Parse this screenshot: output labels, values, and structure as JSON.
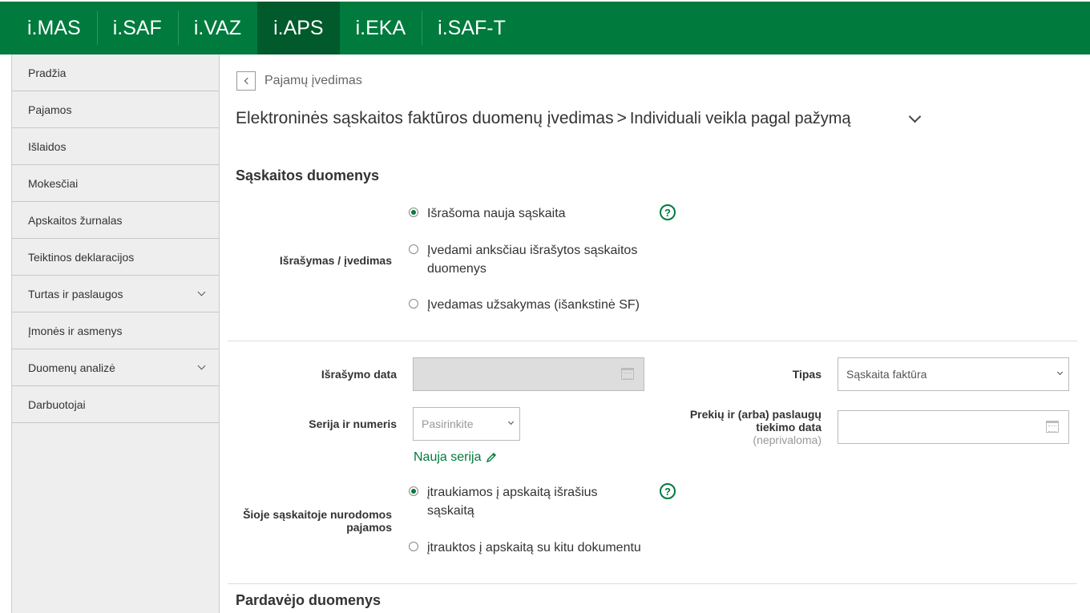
{
  "topnav": {
    "tabs": [
      {
        "label": "i.MAS"
      },
      {
        "label": "i.SAF"
      },
      {
        "label": "i.VAZ"
      },
      {
        "label": "i.APS"
      },
      {
        "label": "i.EKA"
      },
      {
        "label": "i.SAF-T"
      }
    ],
    "active": "i.APS",
    "accent_color": "#007a3d"
  },
  "sidebar": {
    "items": [
      {
        "label": "Pradžia"
      },
      {
        "label": "Pajamos"
      },
      {
        "label": "Išlaidos"
      },
      {
        "label": "Mokesčiai"
      },
      {
        "label": "Apskaitos žurnalas"
      },
      {
        "label": "Teiktinos deklaracijos"
      },
      {
        "label": "Turtas ir paslaugos"
      },
      {
        "label": "Įmonės ir asmenys"
      },
      {
        "label": "Duomenų analizė"
      },
      {
        "label": "Darbuotojai"
      }
    ]
  },
  "breadcrumb": {
    "back_label": "Pajamų įvedimas"
  },
  "heading": {
    "title": "Elektroninės sąskaitos faktūros duomenų įvedimas",
    "separator": ">",
    "subtitle": "Individuali veikla pagal pažymą"
  },
  "invoice_section": {
    "title": "Sąskaitos duomenys",
    "issue_mode": {
      "label": "Išrašymas / įvedimas",
      "options": [
        {
          "label": "Išrašoma nauja sąskaita",
          "selected": true
        },
        {
          "label": "Įvedami anksčiau išrašytos sąskaitos duomenys",
          "selected": false
        },
        {
          "label": "Įvedamas užsakymas (išankstinė SF)",
          "selected": false
        }
      ],
      "help": "?"
    },
    "issue_date": {
      "label": "Išrašymo data",
      "value": ""
    },
    "type": {
      "label": "Tipas",
      "value": "Sąskaita faktūra"
    },
    "series": {
      "label": "Serija ir numeris",
      "placeholder": "Pasirinkite",
      "new_series_link": "Nauja serija"
    },
    "supply_date": {
      "label": "Prekių ir (arba) paslaugų tiekimo data",
      "optional": "(neprivaloma)",
      "value": ""
    },
    "income": {
      "label": "Šioje sąskaitoje nurodomos pajamos",
      "options": [
        {
          "label": "įtraukiamos į apskaitą išrašius sąskaitą",
          "selected": true
        },
        {
          "label": "įtrauktos į apskaitą su kitu dokumentu",
          "selected": false
        }
      ],
      "help": "?"
    }
  },
  "seller_section": {
    "title": "Pardavėjo duomenys"
  }
}
